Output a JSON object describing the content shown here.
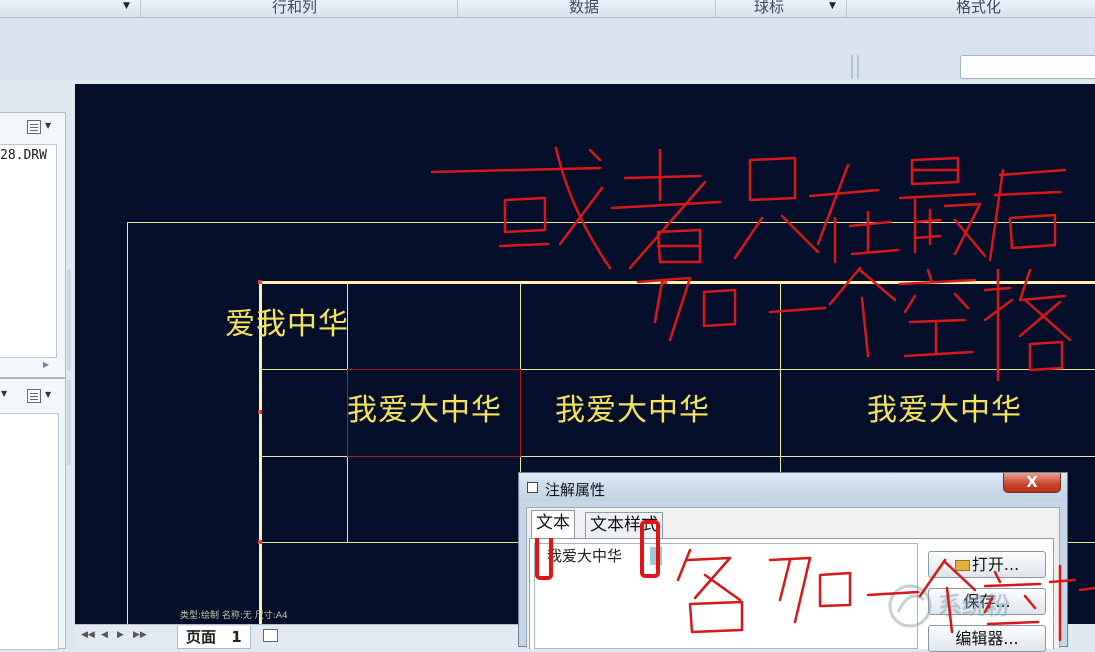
{
  "ribbon": {
    "groups": [
      "行和列",
      "数据",
      "球标",
      "格式化"
    ]
  },
  "model_tree": {
    "file_name": "28.DRW"
  },
  "drawing": {
    "note_header": "爱我中华",
    "cells": [
      "我爱大中华",
      "我爱大中华",
      "我爱大中华"
    ],
    "title_block": "类型:绘制    名称:无    尺寸:A4"
  },
  "page_nav": {
    "page_label": "页面",
    "page_number": "1"
  },
  "dialog": {
    "title": "注解属性",
    "close_label": "X",
    "tabs": [
      "文本",
      "文本样式"
    ],
    "text_value": "我爱大中华",
    "buttons": {
      "open": "打开...",
      "save": "保存...",
      "editor": "编辑器..."
    }
  },
  "annotations": {
    "handwriting_top_line1": "或者只在最后",
    "handwriting_top_line2": "加一个空格",
    "handwriting_bottom": "各加一个空格"
  },
  "watermark": {
    "site": "系统粉"
  },
  "colors": {
    "canvas_bg": "#050f2c",
    "drawing_text": "#f4e35a",
    "annotation_red": "#d81818",
    "dialog_close": "#c9432b"
  }
}
